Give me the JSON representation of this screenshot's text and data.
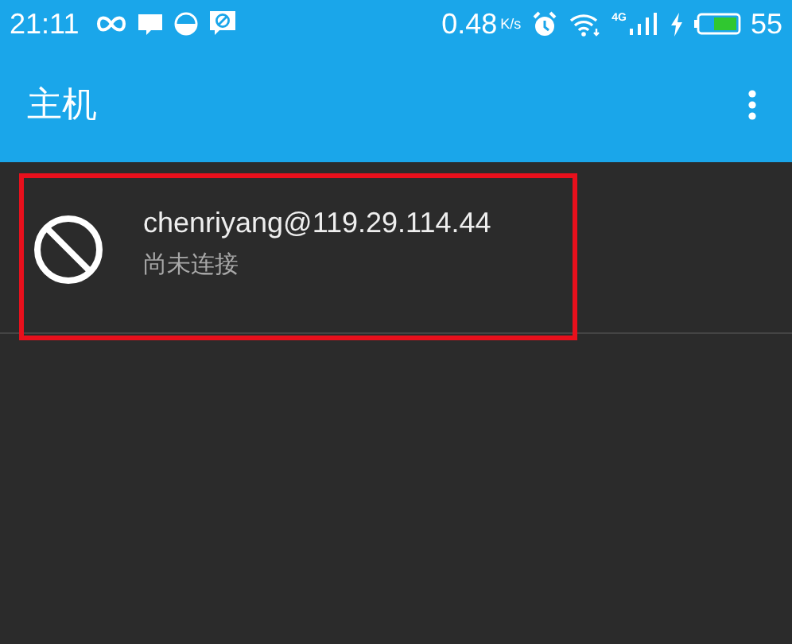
{
  "status_bar": {
    "time": "21:11",
    "net_speed": "0.48",
    "speed_unit": "K/s",
    "network": "4G",
    "battery_percent": "55"
  },
  "app_bar": {
    "title": "主机"
  },
  "hosts": [
    {
      "name": "chenriyang@119.29.114.44",
      "status": "尚未连接",
      "connected": false,
      "highlighted": true
    }
  ]
}
